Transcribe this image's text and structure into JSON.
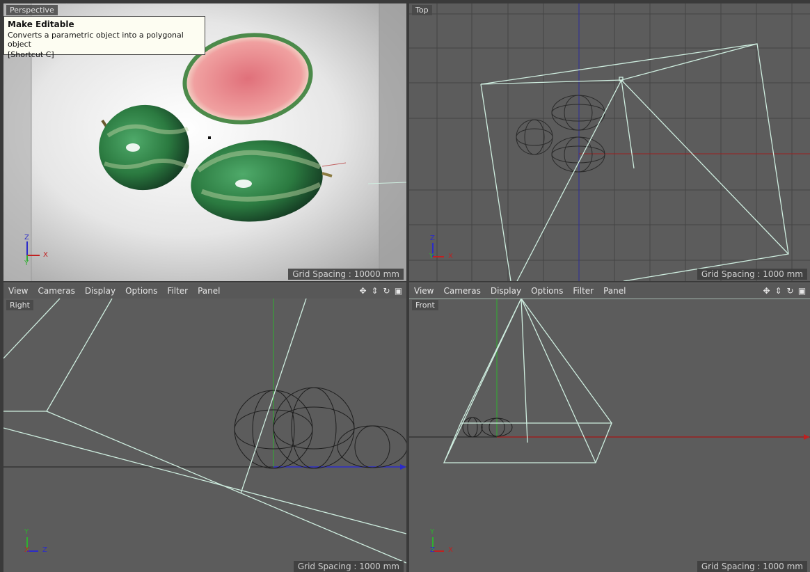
{
  "viewports": {
    "perspective": {
      "label": "Perspective",
      "grid_spacing": "Grid Spacing : 10000 mm"
    },
    "top": {
      "label": "Top",
      "grid_spacing": "Grid Spacing : 1000 mm"
    },
    "right": {
      "label": "Right",
      "grid_spacing": "Grid Spacing : 1000 mm"
    },
    "front": {
      "label": "Front",
      "grid_spacing": "Grid Spacing : 1000 mm"
    }
  },
  "menu": {
    "view": "View",
    "cameras": "Cameras",
    "display": "Display",
    "options": "Options",
    "filter": "Filter",
    "panel": "Panel"
  },
  "tooltip": {
    "title": "Make Editable",
    "description": "Converts a parametric object into a polygonal object",
    "shortcut": "[Shortcut C]"
  },
  "axes": {
    "x": "X",
    "y": "Y",
    "z": "Z"
  },
  "icons": [
    "move-view-icon",
    "scroll-view-icon",
    "rotate-view-icon",
    "toggle-layout-icon"
  ],
  "colors": {
    "x_axis": "#c02020",
    "y_axis": "#2fb030",
    "z_axis": "#2c2cc8",
    "wire": "#cfeee0",
    "viewport_bg": "#5c5c5c"
  }
}
